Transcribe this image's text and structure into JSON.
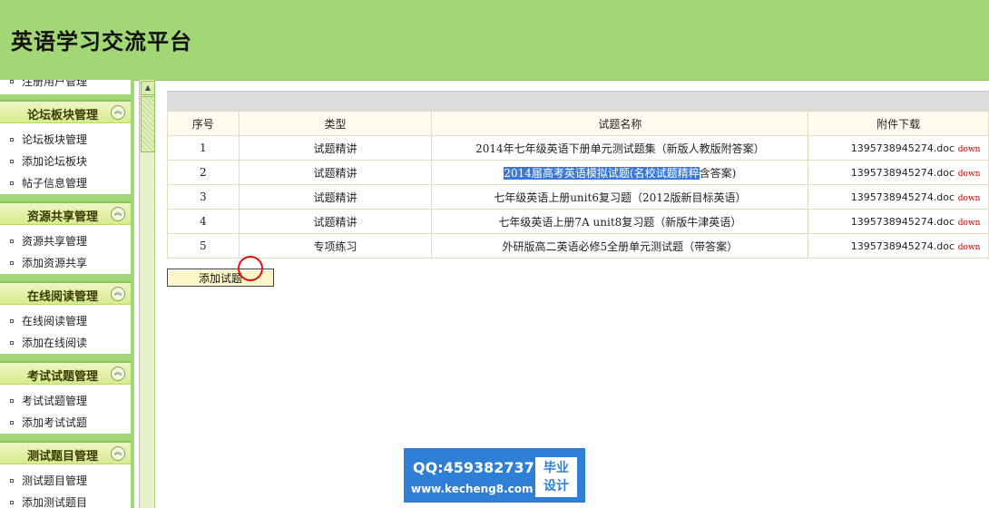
{
  "header": {
    "title": "英语学习交流平台"
  },
  "sidebar": {
    "top_partial_item": "注册用户管理",
    "sections": [
      {
        "title": "论坛板块管理",
        "items": [
          "论坛板块管理",
          "添加论坛板块",
          "帖子信息管理"
        ]
      },
      {
        "title": "资源共享管理",
        "items": [
          "资源共享管理",
          "添加资源共享"
        ]
      },
      {
        "title": "在线阅读管理",
        "items": [
          "在线阅读管理",
          "添加在线阅读"
        ]
      },
      {
        "title": "考试试题管理",
        "items": [
          "考试试题管理",
          "添加考试试题"
        ]
      },
      {
        "title": "测试题目管理",
        "items": [
          "测试题目管理",
          "添加测试题目"
        ]
      }
    ],
    "chevron_icon": "collapse-up-icon"
  },
  "table": {
    "headers": [
      "序号",
      "类型",
      "试题名称",
      "附件下载"
    ],
    "rows": [
      {
        "no": "1",
        "type": "试题精讲",
        "name": "2014年七年级英语下册单元测试题集（新版人教版附答案）",
        "file": "1395738945274.doc",
        "link": "down"
      },
      {
        "no": "2",
        "type": "试题精讲",
        "name_selected": "2014届高考英语模拟试题(名校试题精粹",
        "name_rest": "含答案)",
        "file": "1395738945274.doc",
        "link": "down"
      },
      {
        "no": "3",
        "type": "试题精讲",
        "name": "七年级英语上册unit6复习题（2012版新目标英语）",
        "file": "1395738945274.doc",
        "link": "down"
      },
      {
        "no": "4",
        "type": "试题精讲",
        "name": "七年级英语上册7A unit8复习题（新版牛津英语）",
        "file": "1395738945274.doc",
        "link": "down"
      },
      {
        "no": "5",
        "type": "专项练习",
        "name": "外研版高二英语必修5全册单元测试题（带答案）",
        "file": "1395738945274.doc",
        "link": "down"
      }
    ]
  },
  "add_button": "添加试题",
  "watermark": {
    "qq": "QQ:459382737",
    "url": "www.kecheng8.com",
    "badge_line1": "毕业",
    "badge_line2": "设计"
  },
  "colors": {
    "header_bg": "#a2d775",
    "selection": "#3a78d4",
    "down_link": "#cc0000"
  }
}
